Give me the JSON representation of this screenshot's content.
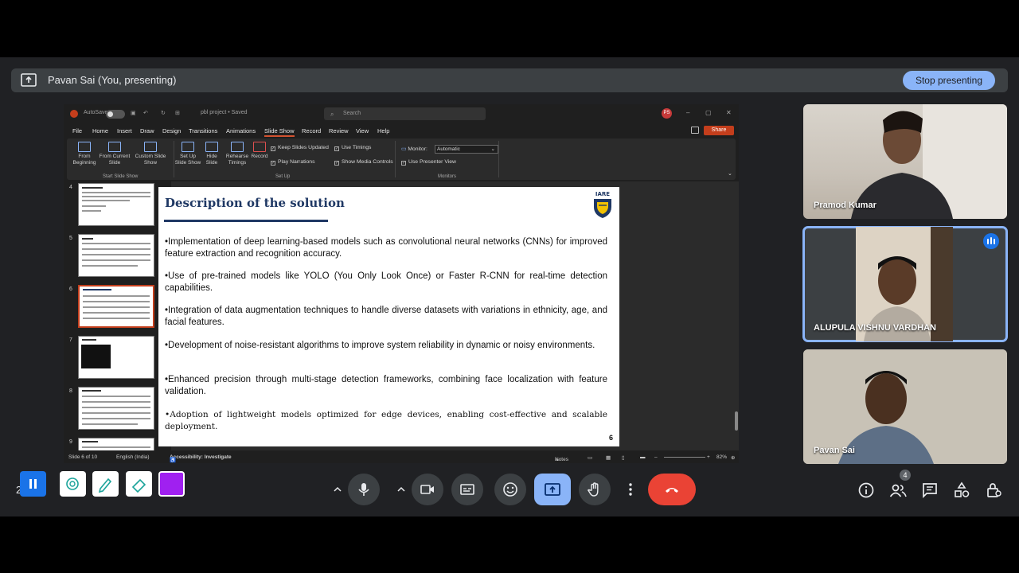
{
  "presenting_bar": {
    "text": "Pavan Sai (You, presenting)",
    "stop_label": "Stop presenting"
  },
  "ppt": {
    "autosave": "AutoSave",
    "filename": "pbl project • Saved",
    "search_placeholder": "Search",
    "user_initials": "PS",
    "share_label": "Share",
    "menu": [
      "File",
      "Home",
      "Insert",
      "Draw",
      "Design",
      "Transitions",
      "Animations",
      "Slide Show",
      "Record",
      "Review",
      "View",
      "Help"
    ],
    "active_menu": "Slide Show",
    "ribbon": {
      "from_beginning": "From Beginning",
      "from_current": "From Current Slide",
      "custom_show": "Custom Slide Show",
      "group_start": "Start Slide Show",
      "setup_show": "Set Up Slide Show",
      "hide_slide": "Hide Slide",
      "rehearse": "Rehearse Timings",
      "record": "Record",
      "keep_updated": "Keep Slides Updated",
      "use_timings": "Use Timings",
      "play_narrations": "Play Narrations",
      "show_media": "Show Media Controls",
      "group_setup": "Set Up",
      "monitor_label": "Monitor:",
      "monitor_value": "Automatic",
      "presenter_view": "Use Presenter View",
      "group_monitors": "Monitors"
    },
    "thumbnails": [
      "4",
      "5",
      "6",
      "7",
      "8",
      "9"
    ],
    "selected_thumbnail": "6",
    "slide": {
      "title": "Description of the solution",
      "bullets": [
        "•Implementation of deep learning-based models such as convolutional neural networks (CNNs) for improved feature extraction and recognition accuracy.",
        "•Use of pre-trained models like YOLO (You Only Look Once) or Faster R-CNN for real-time detection capabilities.",
        "•Integration of data augmentation techniques to handle diverse datasets with variations in ethnicity, age, and facial features.",
        "•Development of noise-resistant algorithms to improve system reliability in dynamic or noisy environments.",
        "•Enhanced precision through multi-stage detection frameworks, combining face localization with feature validation.",
        "•Adoption of lightweight models optimized for edge devices, enabling cost-effective and scalable deployment."
      ],
      "number": "6",
      "logo_text": "IARE"
    },
    "status": {
      "slide_of": "Slide 6 of 10",
      "language": "English (India)",
      "accessibility": "Accessibility: Investigate",
      "notes": "Notes",
      "zoom": "82%"
    }
  },
  "participants": [
    {
      "name": "Pramod Kumar"
    },
    {
      "name": "ALUPULA VISHNU VARDHAN"
    },
    {
      "name": "Pavan Sai"
    }
  ],
  "participant_count": "4",
  "colors": {
    "accent": "#8ab4f8",
    "leave": "#ea4335",
    "ppt_brand": "#c43e1c"
  }
}
